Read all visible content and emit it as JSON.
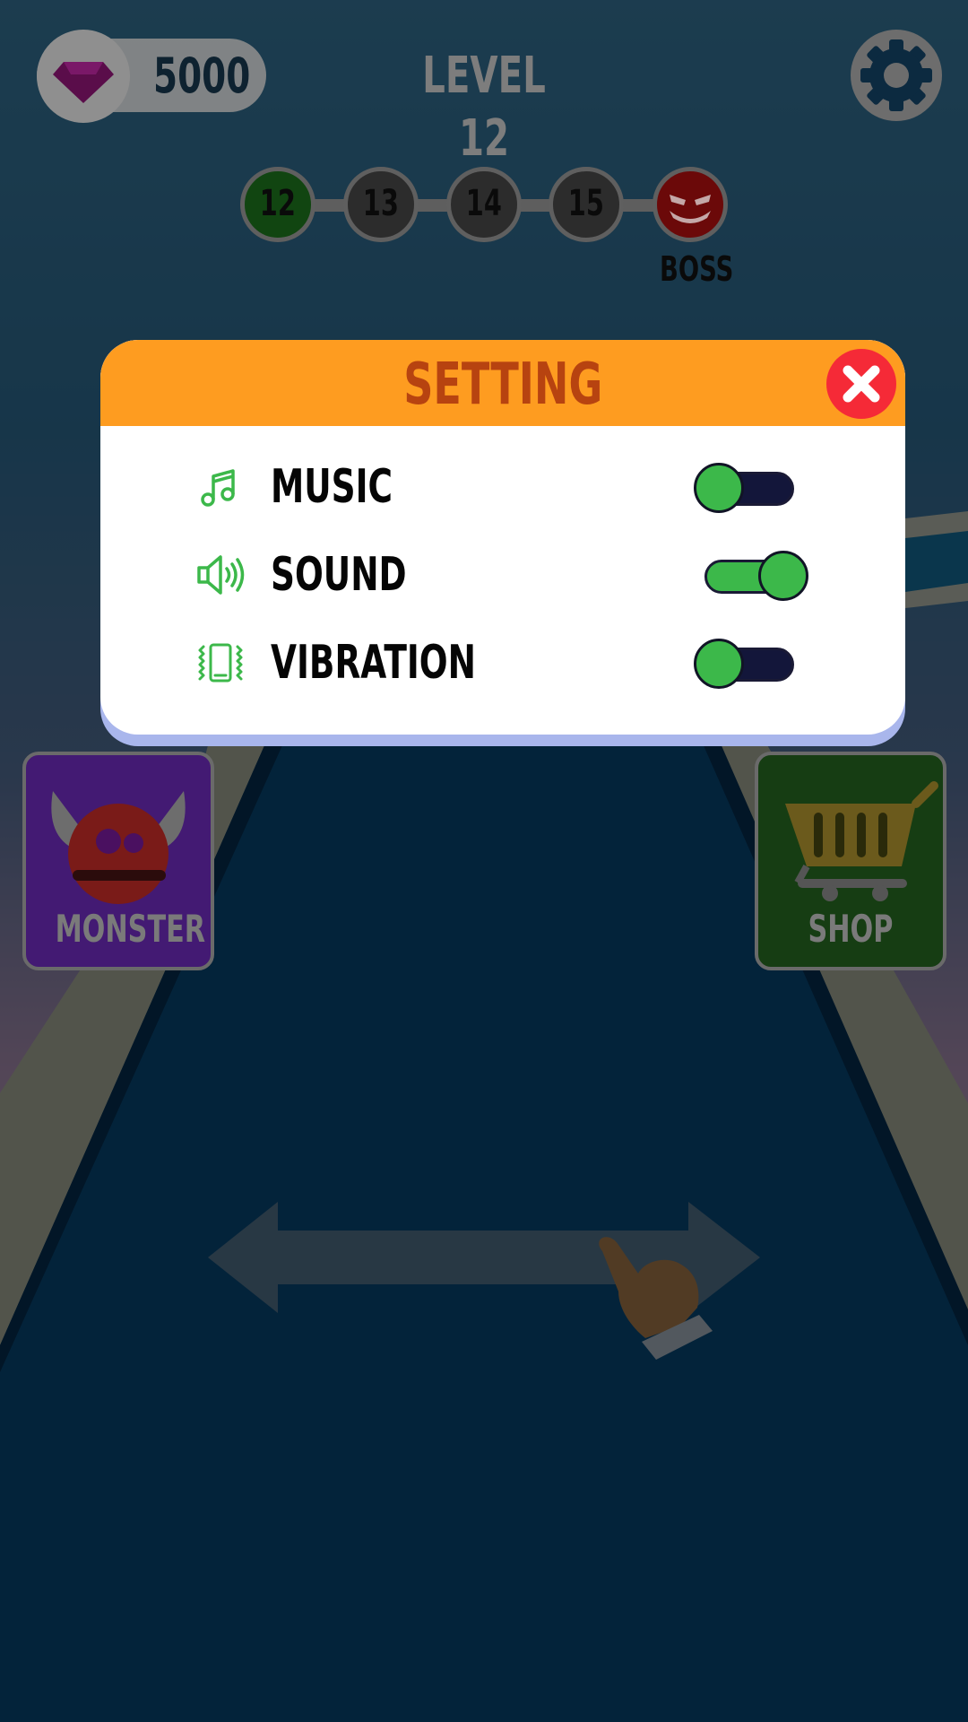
{
  "hud": {
    "gems": "5000",
    "level_title": "LEVEL 12"
  },
  "progress": {
    "levels": [
      "12",
      "13",
      "14",
      "15"
    ],
    "boss_label": "BOSS"
  },
  "side_buttons": {
    "monster_label": "MONSTER",
    "shop_label": "SHOP"
  },
  "dialog": {
    "title": "SETTING",
    "rows": [
      {
        "label": "MUSIC",
        "icon": "music-note-icon",
        "enabled": false
      },
      {
        "label": "SOUND",
        "icon": "speaker-icon",
        "enabled": true
      },
      {
        "label": "VIBRATION",
        "icon": "vibration-icon",
        "enabled": false
      }
    ]
  },
  "colors": {
    "header": "#fe9c20",
    "title": "#b74310",
    "toggle_on": "#3cb84a",
    "toggle_off": "#13163a",
    "close": "#f52a37"
  }
}
